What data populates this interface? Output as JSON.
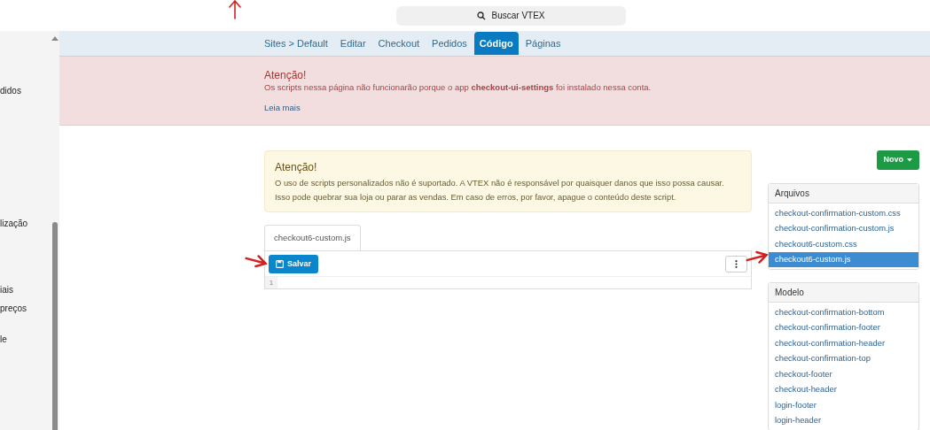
{
  "search": {
    "label": "Buscar VTEX"
  },
  "sidebar": {
    "items": [
      {
        "label": "didos"
      },
      {
        "label": "lização"
      },
      {
        "label": "iais"
      },
      {
        "label": "preços"
      },
      {
        "label": "le"
      }
    ]
  },
  "tabs": [
    {
      "label": "Sites > Default",
      "selected": false
    },
    {
      "label": "Editar",
      "selected": false
    },
    {
      "label": "Checkout",
      "selected": false
    },
    {
      "label": "Pedidos",
      "selected": false
    },
    {
      "label": "Código",
      "selected": true
    },
    {
      "label": "Páginas",
      "selected": false
    }
  ],
  "danger_alert": {
    "title": "Atenção!",
    "text": "Os scripts nessa página não funcionarão porque o app **checkout-ui-settings** foi instalado nessa conta.",
    "link": "Leia mais"
  },
  "warning_alert": {
    "title": "Atenção!",
    "lines": [
      "O uso de scripts personalizados não é suportado. A VTEX não é responsável por quaisquer danos que isso possa causar.",
      "Isso pode quebrar sua loja ou parar as vendas. Em caso de erros, por favor, apague o conteúdo deste script."
    ]
  },
  "editor": {
    "tab": "checkout6-custom.js",
    "save_button": "Salvar",
    "line_numbers": [
      "1"
    ]
  },
  "new_button": "Novo",
  "files_panel": {
    "title": "Arquivos",
    "items": [
      {
        "label": "checkout-confirmation-custom.css",
        "selected": false
      },
      {
        "label": "checkout-confirmation-custom.js",
        "selected": false
      },
      {
        "label": "checkout6-custom.css",
        "selected": false
      },
      {
        "label": "checkout6-custom.js",
        "selected": true
      }
    ]
  },
  "template_panel": {
    "title": "Modelo",
    "items": [
      {
        "label": "checkout-confirmation-bottom"
      },
      {
        "label": "checkout-confirmation-footer"
      },
      {
        "label": "checkout-confirmation-header"
      },
      {
        "label": "checkout-confirmation-top"
      },
      {
        "label": "checkout-footer"
      },
      {
        "label": "checkout-header"
      },
      {
        "label": "login-footer"
      },
      {
        "label": "login-header"
      }
    ]
  }
}
